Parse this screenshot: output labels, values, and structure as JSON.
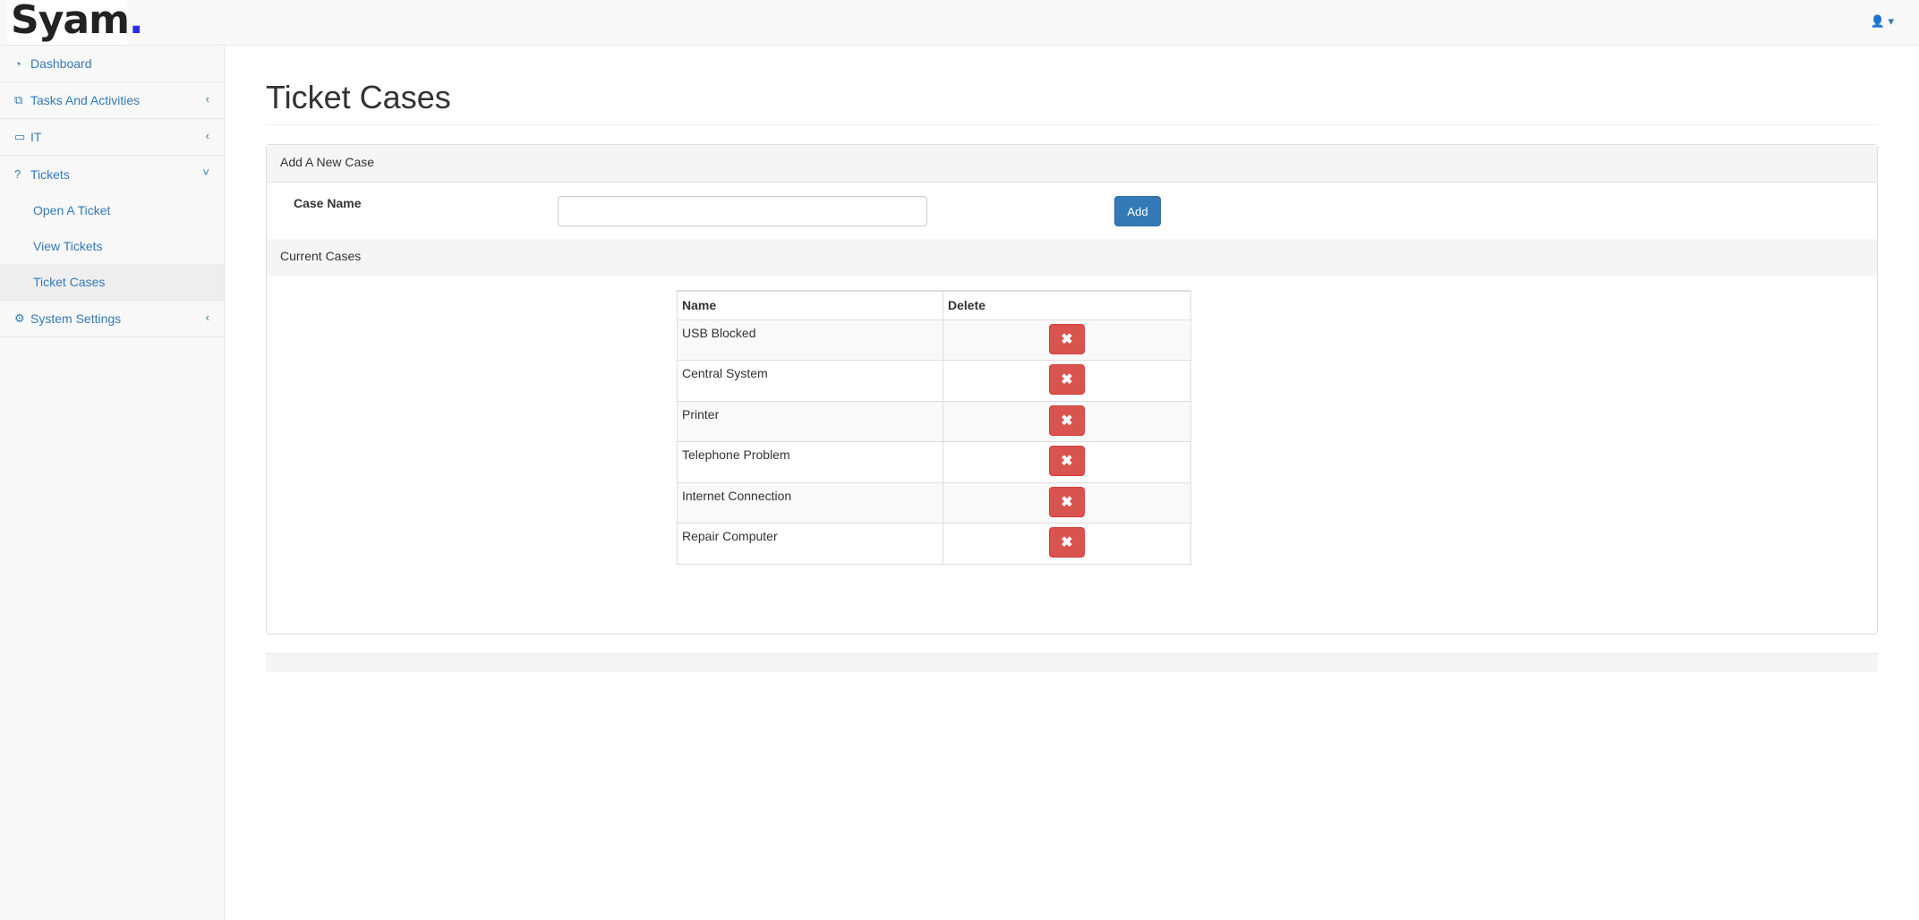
{
  "logo": {
    "text": "Syam",
    "dot": "."
  },
  "header": {
    "user_icon": "user-icon",
    "caret": "▾"
  },
  "sidebar": {
    "items": [
      {
        "label": "Dashboard",
        "icon": "dashboard-icon"
      },
      {
        "label": "Tasks And Activities",
        "icon": "copy-icon"
      },
      {
        "label": "IT",
        "icon": "desktop-icon"
      },
      {
        "label": "Tickets",
        "icon": "question-circle-icon"
      },
      {
        "label": "System Settings",
        "icon": "gear-icon"
      }
    ],
    "subitems": [
      "Open A Ticket",
      "View Tickets",
      "Ticket Cases"
    ]
  },
  "page": {
    "title": "Ticket Cases"
  },
  "add_panel": {
    "heading": "Add A New Case",
    "label": "Case Name",
    "value": "",
    "button": "Add"
  },
  "current": {
    "heading": "Current Cases",
    "columns": [
      "Name",
      "Delete"
    ],
    "rows": [
      "USB Blocked",
      "Central System",
      "Printer",
      "Telephone Problem",
      "Internet Connection",
      "Repair Computer"
    ]
  },
  "colors": {
    "primary": "#337ab7",
    "danger": "#d9534f"
  }
}
